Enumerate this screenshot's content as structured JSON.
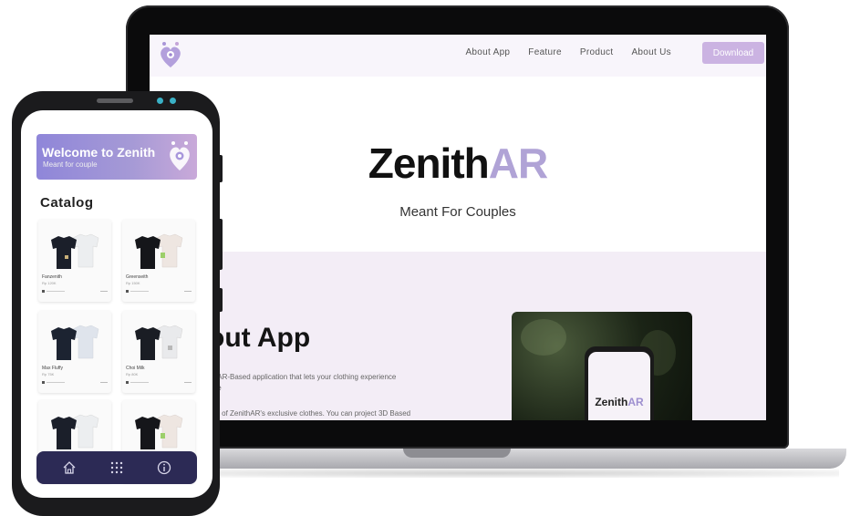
{
  "website": {
    "nav": {
      "links": [
        "About App",
        "Feature",
        "Product",
        "About Us"
      ],
      "download_label": "Download"
    },
    "hero": {
      "title_main": "Zenith",
      "title_accent": "AR",
      "subtitle": "Meant For Couples"
    },
    "about": {
      "heading": "out App",
      "line1": "a AR-Based application that lets your clothing experience",
      "line2": "ble",
      "line3": "air of ZenithAR's exclusive clothes. You can project 3D Based",
      "photo_logo_main": "Zenith",
      "photo_logo_accent": "AR"
    }
  },
  "mobile": {
    "welcome": {
      "title": "Welcome to Zenith",
      "subtitle": "Meant for couple"
    },
    "catalog_title": "Catalog",
    "products": [
      {
        "name": "Fanzenith",
        "price": "Rp 120K"
      },
      {
        "name": "Greenseith",
        "price": "Rp 150K"
      },
      {
        "name": "Max Fluffy",
        "price": "Rp 75K"
      },
      {
        "name": "Choi Milk",
        "price": "Rp 80K"
      },
      {
        "name": "",
        "price": ""
      },
      {
        "name": "",
        "price": ""
      }
    ],
    "bottom_nav_icons": [
      "home-icon",
      "grid-icon",
      "info-icon"
    ]
  },
  "colors": {
    "accent_purple": "#b0a3d6",
    "download_bg": "#cbb3e2",
    "bottom_nav_bg": "#2c2a55",
    "about_bg": "#f3edf6"
  }
}
